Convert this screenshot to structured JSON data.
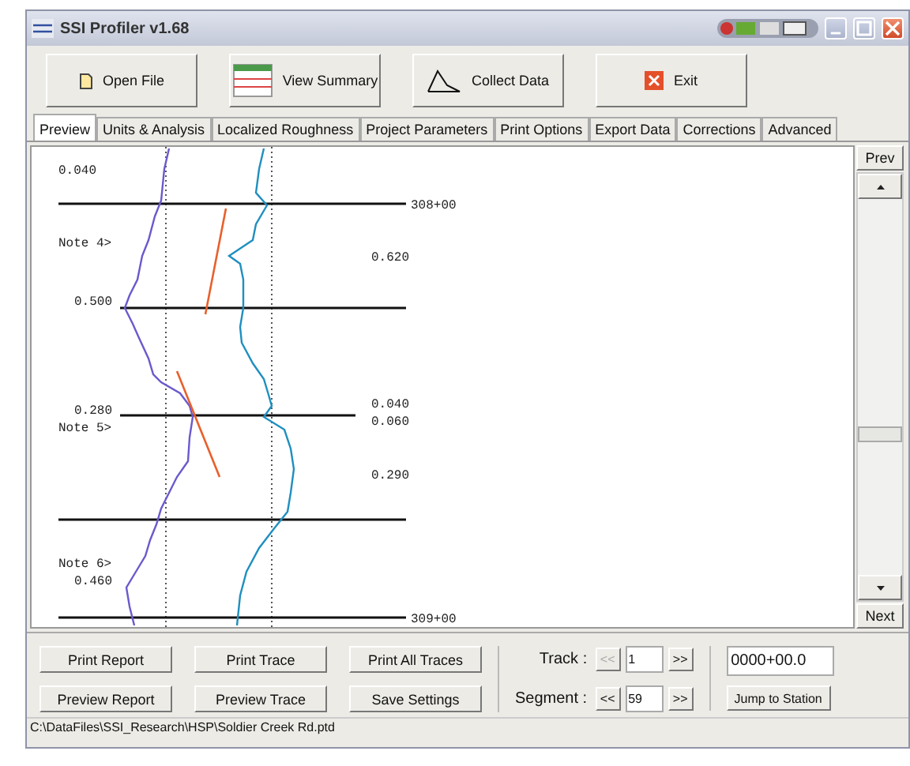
{
  "window": {
    "title": "SSI Profiler v1.68"
  },
  "toolbar": [
    {
      "label": "Open File",
      "kind": "file"
    },
    {
      "label": "View Summary",
      "kind": "summary"
    },
    {
      "label": "Collect Data",
      "kind": "curve"
    },
    {
      "label": "Exit",
      "kind": "exit"
    }
  ],
  "tabs": [
    {
      "label": "Preview",
      "selected": true
    },
    {
      "label": "Units & Analysis",
      "selected": false
    },
    {
      "label": "Localized Roughness",
      "selected": false
    },
    {
      "label": "Project Parameters",
      "selected": false
    },
    {
      "label": "Print Options",
      "selected": false
    },
    {
      "label": "Export Data",
      "selected": false
    },
    {
      "label": "Corrections",
      "selected": false
    },
    {
      "label": "Advanced",
      "selected": false
    }
  ],
  "preview": {
    "stations": [
      "308+00",
      "309+00"
    ],
    "notes": [
      "Note 4>",
      "Note 5>",
      "Note 6>"
    ],
    "left_values": [
      "0.040",
      "0.500",
      "0.280",
      "0.460"
    ],
    "right_values": [
      "0.620",
      "0.040",
      "0.060",
      "0.290"
    ],
    "prev_button": "Prev",
    "next_button": "Next"
  },
  "actions": [
    "Print Report",
    "Print Trace",
    "Print All Traces",
    "Preview Report",
    "Preview Trace",
    "Save Settings"
  ],
  "navigators": [
    {
      "label": "Track :",
      "value": "1",
      "back": "<<",
      "forward": ">>",
      "back_disabled": true,
      "forward_disabled": false
    },
    {
      "label": "Segment :",
      "value": "59",
      "back": "<<",
      "forward": ">>",
      "back_disabled": false,
      "forward_disabled": false
    }
  ],
  "station_field": {
    "value": "0000+00.0"
  },
  "jump_button": "Jump to Station",
  "status_bar": "C:\\DataFiles\\SSI_Research\\HSP\\Soldier Creek Rd.ptd"
}
